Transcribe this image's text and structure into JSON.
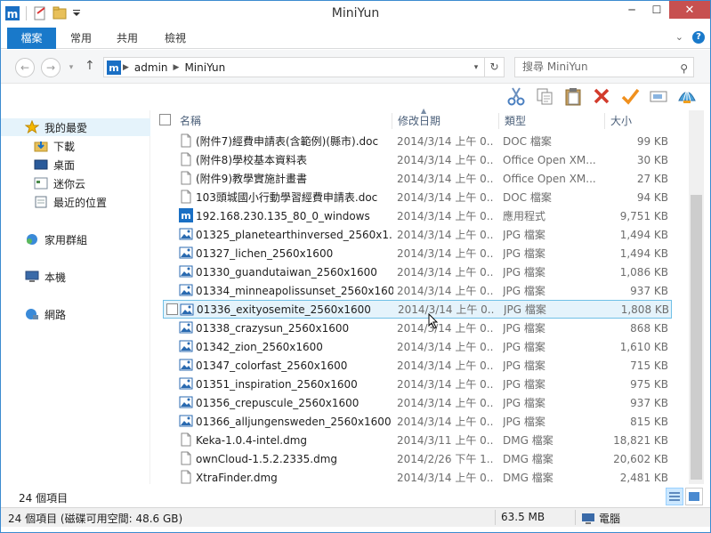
{
  "window": {
    "title": "MiniYun"
  },
  "ribbon": {
    "tabs": [
      "檔案",
      "常用",
      "共用",
      "檢視"
    ]
  },
  "address": {
    "segments": [
      "admin",
      "MiniYun"
    ]
  },
  "search": {
    "placeholder": "搜尋 MiniYun"
  },
  "nav_pane": {
    "items": [
      {
        "label": "我的最愛",
        "icon": "star-icon"
      },
      {
        "label": "下載",
        "icon": "downloads-folder-icon"
      },
      {
        "label": "桌面",
        "icon": "desktop-icon"
      },
      {
        "label": "迷你云",
        "icon": "miniyun-icon"
      },
      {
        "label": "最近的位置",
        "icon": "recent-places-icon"
      },
      {
        "label": "家用群組",
        "icon": "homegroup-icon"
      },
      {
        "label": "本機",
        "icon": "computer-icon"
      },
      {
        "label": "網路",
        "icon": "network-icon"
      }
    ]
  },
  "columns": {
    "name": "名稱",
    "date": "修改日期",
    "type": "類型",
    "size": "大小"
  },
  "files": [
    {
      "name": "(附件7)經費申請表(含範例)(縣市).doc",
      "date": "2014/3/14 上午 0...",
      "type": "DOC 檔案",
      "size": "99 KB",
      "icon": "doc"
    },
    {
      "name": "(附件8)學校基本資料表",
      "date": "2014/3/14 上午 0...",
      "type": "Office Open XM...",
      "size": "30 KB",
      "icon": "doc"
    },
    {
      "name": "(附件9)教學實施計畫書",
      "date": "2014/3/14 上午 0...",
      "type": "Office Open XM...",
      "size": "27 KB",
      "icon": "doc"
    },
    {
      "name": "103頭城國小行動學習經費申請表.doc",
      "date": "2014/3/14 上午 0...",
      "type": "DOC 檔案",
      "size": "94 KB",
      "icon": "doc"
    },
    {
      "name": "192.168.230.135_80_0_windows",
      "date": "2014/3/14 上午 0...",
      "type": "應用程式",
      "size": "9,751 KB",
      "icon": "app"
    },
    {
      "name": "01325_planetearthinversed_2560x1...",
      "date": "2014/3/14 上午 0...",
      "type": "JPG 檔案",
      "size": "1,494 KB",
      "icon": "img"
    },
    {
      "name": "01327_lichen_2560x1600",
      "date": "2014/3/14 上午 0...",
      "type": "JPG 檔案",
      "size": "1,494 KB",
      "icon": "img"
    },
    {
      "name": "01330_guandutaiwan_2560x1600",
      "date": "2014/3/14 上午 0...",
      "type": "JPG 檔案",
      "size": "1,086 KB",
      "icon": "img"
    },
    {
      "name": "01334_minneapolissunset_2560x1600",
      "date": "2014/3/14 上午 0...",
      "type": "JPG 檔案",
      "size": "937 KB",
      "icon": "img"
    },
    {
      "name": "01336_exityosemite_2560x1600",
      "date": "2014/3/14 上午 0...",
      "type": "JPG 檔案",
      "size": "1,808 KB",
      "icon": "img"
    },
    {
      "name": "01338_crazysun_2560x1600",
      "date": "2014/3/14 上午 0...",
      "type": "JPG 檔案",
      "size": "868 KB",
      "icon": "img"
    },
    {
      "name": "01342_zion_2560x1600",
      "date": "2014/3/14 上午 0...",
      "type": "JPG 檔案",
      "size": "1,610 KB",
      "icon": "img"
    },
    {
      "name": "01347_colorfast_2560x1600",
      "date": "2014/3/14 上午 0...",
      "type": "JPG 檔案",
      "size": "715 KB",
      "icon": "img"
    },
    {
      "name": "01351_inspiration_2560x1600",
      "date": "2014/3/14 上午 0...",
      "type": "JPG 檔案",
      "size": "975 KB",
      "icon": "img"
    },
    {
      "name": "01356_crepuscule_2560x1600",
      "date": "2014/3/14 上午 0...",
      "type": "JPG 檔案",
      "size": "937 KB",
      "icon": "img"
    },
    {
      "name": "01366_alljungensweden_2560x1600",
      "date": "2014/3/14 上午 0...",
      "type": "JPG 檔案",
      "size": "815 KB",
      "icon": "img"
    },
    {
      "name": "Keka-1.0.4-intel.dmg",
      "date": "2014/3/11 上午 0...",
      "type": "DMG 檔案",
      "size": "18,821 KB",
      "icon": "doc"
    },
    {
      "name": "ownCloud-1.5.2.2335.dmg",
      "date": "2014/2/26 下午 1...",
      "type": "DMG 檔案",
      "size": "20,602 KB",
      "icon": "doc"
    },
    {
      "name": "XtraFinder.dmg",
      "date": "2014/3/14 上午 0...",
      "type": "DMG 檔案",
      "size": "2,481 KB",
      "icon": "doc"
    }
  ],
  "status": {
    "item_count": "24 個項目",
    "bar_left": "24 個項目 (磁碟可用空間: 48.6 GB)",
    "bar_size": "63.5 MB",
    "bar_location": "電腦"
  }
}
